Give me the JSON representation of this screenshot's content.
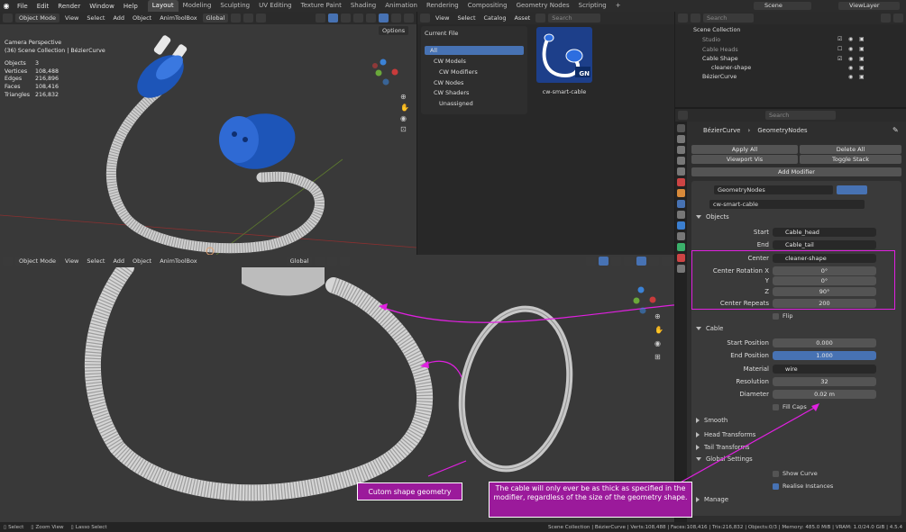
{
  "topbar": {
    "menus": [
      "File",
      "Edit",
      "Render",
      "Window",
      "Help"
    ],
    "workspaces": [
      "Layout",
      "Modeling",
      "Sculpting",
      "UV Editing",
      "Texture Paint",
      "Shading",
      "Animation",
      "Rendering",
      "Compositing",
      "Geometry Nodes",
      "Scripting"
    ],
    "plus": "+",
    "scene": "Scene",
    "view_layer": "ViewLayer"
  },
  "viewport_top": {
    "mode": "Object Mode",
    "menus": [
      "View",
      "Select",
      "Add",
      "Object",
      "AnimToolBox"
    ],
    "orientation": "Global",
    "options": "Options",
    "camera_label": "Camera Perspective",
    "collection_label": "(36) Scene Collection | BézierCurve",
    "stats": [
      {
        "label": "Objects",
        "value": "3"
      },
      {
        "label": "Vertices",
        "value": "108,488"
      },
      {
        "label": "Edges",
        "value": "216,896"
      },
      {
        "label": "Faces",
        "value": "108,416"
      },
      {
        "label": "Triangles",
        "value": "216,832"
      }
    ]
  },
  "asset_browser": {
    "menus": [
      "View",
      "Select",
      "Catalog",
      "Asset"
    ],
    "library": "Current File",
    "search_placeholder": "Search",
    "catalogs": [
      "All",
      "CW Models",
      "CW Modifiers",
      "CW Nodes",
      "CW Shaders",
      "Unassigned"
    ],
    "asset_name": "cw-smart-cable",
    "asset_badge": "GN"
  },
  "outliner": {
    "search_placeholder": "Search",
    "items": [
      "Scene Collection",
      "Studio",
      "Cable Heads",
      "Cable Shape",
      "cleaner-shape",
      "BézierCurve"
    ]
  },
  "viewport_bottom": {
    "mode": "Object Mode",
    "menus": [
      "View",
      "Select",
      "Add",
      "Object",
      "AnimToolBox"
    ],
    "orientation": "Global"
  },
  "properties": {
    "search_placeholder": "Search",
    "breadcrumb_object": "BézierCurve",
    "breadcrumb_modifier": "GeometryNodes",
    "apply_all": "Apply All",
    "delete_all": "Delete All",
    "viewport_vis": "Viewport Vis",
    "toggle_stack": "Toggle Stack",
    "add_modifier": "Add Modifier",
    "modifier_name": "GeometryNodes",
    "node_group": "cw-smart-cable",
    "objects_section": "Objects",
    "start_label": "Start",
    "start_value": "Cable_head",
    "end_label": "End",
    "end_value": "Cable_tail",
    "center_label": "Center",
    "center_value": "cleaner-shape",
    "rot_x_label": "Center Rotation X",
    "rot_x": "0°",
    "rot_y_label": "Y",
    "rot_y": "0°",
    "rot_z_label": "Z",
    "rot_z": "90°",
    "repeats_label": "Center Repeats",
    "repeats": "200",
    "flip_label": "Flip",
    "cable_section": "Cable",
    "start_pos_label": "Start Position",
    "start_pos": "0.000",
    "end_pos_label": "End Position",
    "end_pos": "1.000",
    "material_label": "Material",
    "material": "wire",
    "resolution_label": "Resolution",
    "resolution": "32",
    "diameter_label": "Diameter",
    "diameter": "0.02 m",
    "fill_caps_label": "Fill Caps",
    "smooth": "Smooth",
    "head_transforms": "Head Transforms",
    "tail_transforms": "Tail Transforms",
    "global_settings": "Global Settings",
    "show_curve": "Show Curve",
    "realise_instances": "Realise Instances",
    "manage": "Manage"
  },
  "callouts": {
    "shape": "Cutom shape geometry",
    "note": "The cable will only ever be as thick as specified in the modifier, regardless of the size of the geometry shape."
  },
  "statusbar": {
    "select": "Select",
    "zoom": "Zoom View",
    "lasso": "Lasso Select",
    "info": "Scene Collection | BézierCurve | Verts:108,488 | Faces:108,416 | Tris:216,832 | Objects:0/3 | Memory: 485.0 MiB | VRAM: 1.0/24.0 GiB | 4.5.4"
  },
  "colors": {
    "accent": "#4772b3",
    "callout": "#9b1a9b",
    "callout_line": "#e020e0",
    "plug_blue": "#1d55b8"
  }
}
